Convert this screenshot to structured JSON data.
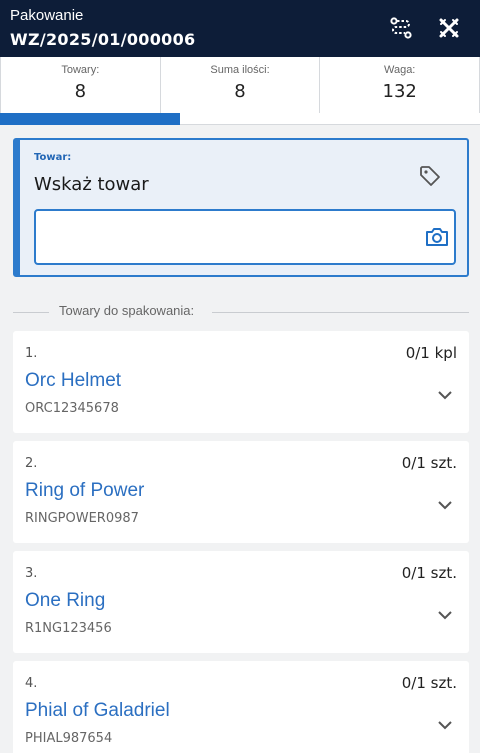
{
  "header": {
    "doc_type": "Pakowanie",
    "doc_number": "WZ/2025/01/000006"
  },
  "stats": [
    {
      "label": "Towary:",
      "value": "8"
    },
    {
      "label": "Suma ilości:",
      "value": "8"
    },
    {
      "label": "Waga:",
      "value": "132"
    }
  ],
  "progress": {
    "fraction": 0.375
  },
  "scan": {
    "field_label": "Towar:",
    "prompt": "Wskaż towar",
    "input_value": "",
    "input_placeholder": ""
  },
  "section": {
    "title": "Towary do spakowania:"
  },
  "items": [
    {
      "index": "1.",
      "qty": "0/1 kpl",
      "name": "Orc Helmet",
      "code": "ORC12345678"
    },
    {
      "index": "2.",
      "qty": "0/1 szt.",
      "name": "Ring of Power",
      "code": "RINGPOWER0987"
    },
    {
      "index": "3.",
      "qty": "0/1 szt.",
      "name": "One Ring",
      "code": "R1NG123456"
    },
    {
      "index": "4.",
      "qty": "0/1 szt.",
      "name": "Phial of Galadriel",
      "code": "PHIAL987654"
    }
  ],
  "icons": {
    "route": "route-icon",
    "close": "close-icon",
    "tag": "tag-icon",
    "camera": "camera-icon",
    "chevron": "chevron-down-icon"
  },
  "colors": {
    "header_bg": "#0d1d38",
    "accent": "#2d7bcc",
    "progress": "#1f6fc5",
    "item_name": "#2b6fc1"
  }
}
